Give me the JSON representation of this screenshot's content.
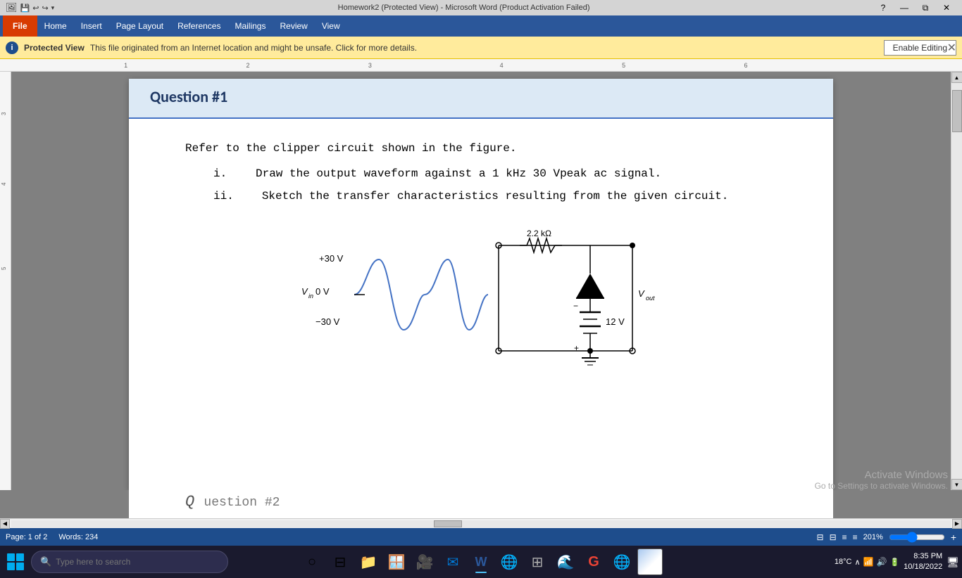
{
  "titlebar": {
    "title": "Homework2 (Protected View) - Microsoft Word (Product Activation Failed)",
    "left_icons": "🖼️ 💾 ↩ ↪ ▾",
    "min_label": "—",
    "restore_label": "⧉",
    "close_label": "✕",
    "help_label": "?"
  },
  "menu": {
    "file_label": "File",
    "items": [
      "Home",
      "Insert",
      "Page Layout",
      "References",
      "Mailings",
      "Review",
      "View"
    ]
  },
  "protected_bar": {
    "label": "Protected View",
    "message": "This file originated from an Internet location and might be unsafe. Click for more details.",
    "enable_button": "Enable Editing",
    "close_label": "✕"
  },
  "document": {
    "question_title": "Question #1",
    "body_text": "Refer to the clipper circuit shown in the figure.",
    "list_items": [
      {
        "num": "i.",
        "text": "Draw the output waveform against a 1 kHz 30 Vpeak ac signal."
      },
      {
        "num": "ii.",
        "text": "Sketch the transfer characteristics resulting from the given circuit."
      }
    ],
    "circuit": {
      "vin_labels": [
        "+30 V",
        "0 V",
        "−30 V"
      ],
      "vin_label": "V",
      "vin_sub": "in",
      "resistor_label": "2.2 kΩ",
      "battery_label": "12 V",
      "vout_label": "V",
      "vout_sub": "out"
    }
  },
  "status_bar": {
    "page": "Page: 1 of 2",
    "words": "Words: 234",
    "zoom": "201%"
  },
  "taskbar": {
    "search_placeholder": "Type here to search",
    "apps": [
      "⊞",
      "○",
      "⊟",
      "📁",
      "🪟",
      "🎥",
      "✉",
      "W",
      "🌐",
      "⊞",
      "🌊",
      "G",
      "🌐"
    ],
    "time": "8:35 PM",
    "date": "10/18/2022",
    "temp": "18°C"
  },
  "activate_watermark": {
    "line1": "Activate Windows",
    "line2": "Go to Settings to activate Windows."
  }
}
